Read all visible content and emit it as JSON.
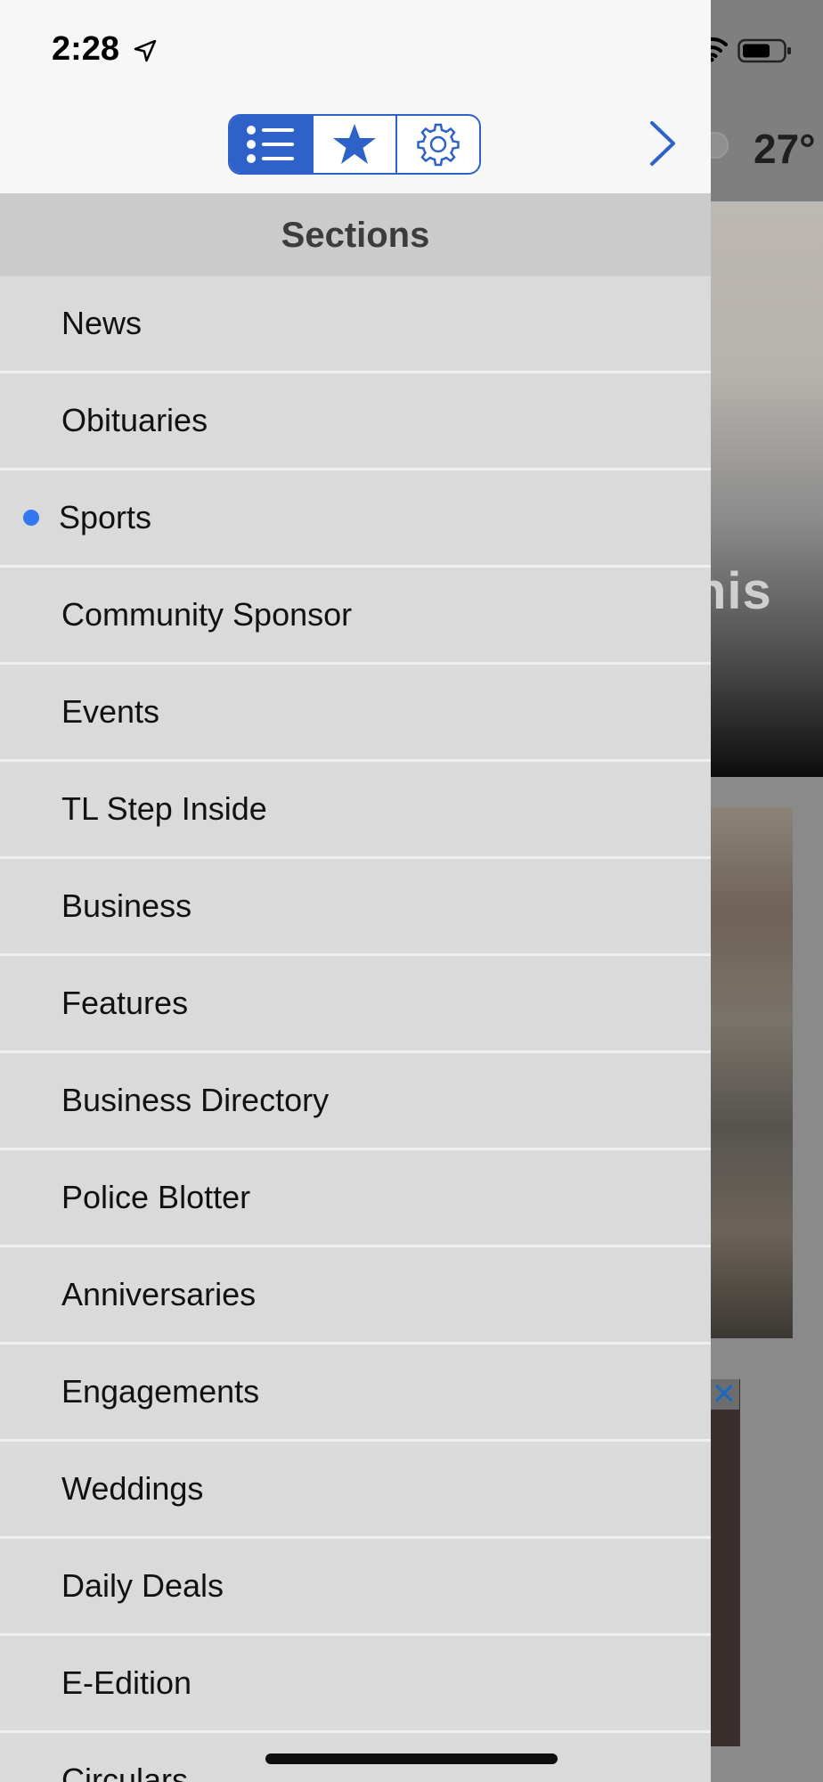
{
  "status_bar": {
    "time": "2:28"
  },
  "background": {
    "temperature": "27°",
    "hero_text_fragment": "nis"
  },
  "drawer": {
    "tabs": [
      {
        "name": "sections",
        "icon": "list-icon",
        "active": true
      },
      {
        "name": "favorites",
        "icon": "star-icon",
        "active": false
      },
      {
        "name": "settings",
        "icon": "gear-icon",
        "active": false
      }
    ],
    "header": "Sections",
    "items": [
      {
        "label": "News"
      },
      {
        "label": "Obituaries"
      },
      {
        "label": "Sports",
        "selected": true
      },
      {
        "label": "Community Sponsor"
      },
      {
        "label": "Events"
      },
      {
        "label": "TL Step Inside"
      },
      {
        "label": "Business"
      },
      {
        "label": "Features"
      },
      {
        "label": "Business Directory"
      },
      {
        "label": "Police Blotter"
      },
      {
        "label": "Anniversaries"
      },
      {
        "label": "Engagements"
      },
      {
        "label": "Weddings"
      },
      {
        "label": "Daily Deals"
      },
      {
        "label": "E-Edition"
      },
      {
        "label": "Circulars"
      }
    ]
  },
  "colors": {
    "accent": "#2f62c9",
    "selected_dot": "#3478f0",
    "drawer_bg": "#dadada",
    "header_bg": "#cbcbcb"
  }
}
